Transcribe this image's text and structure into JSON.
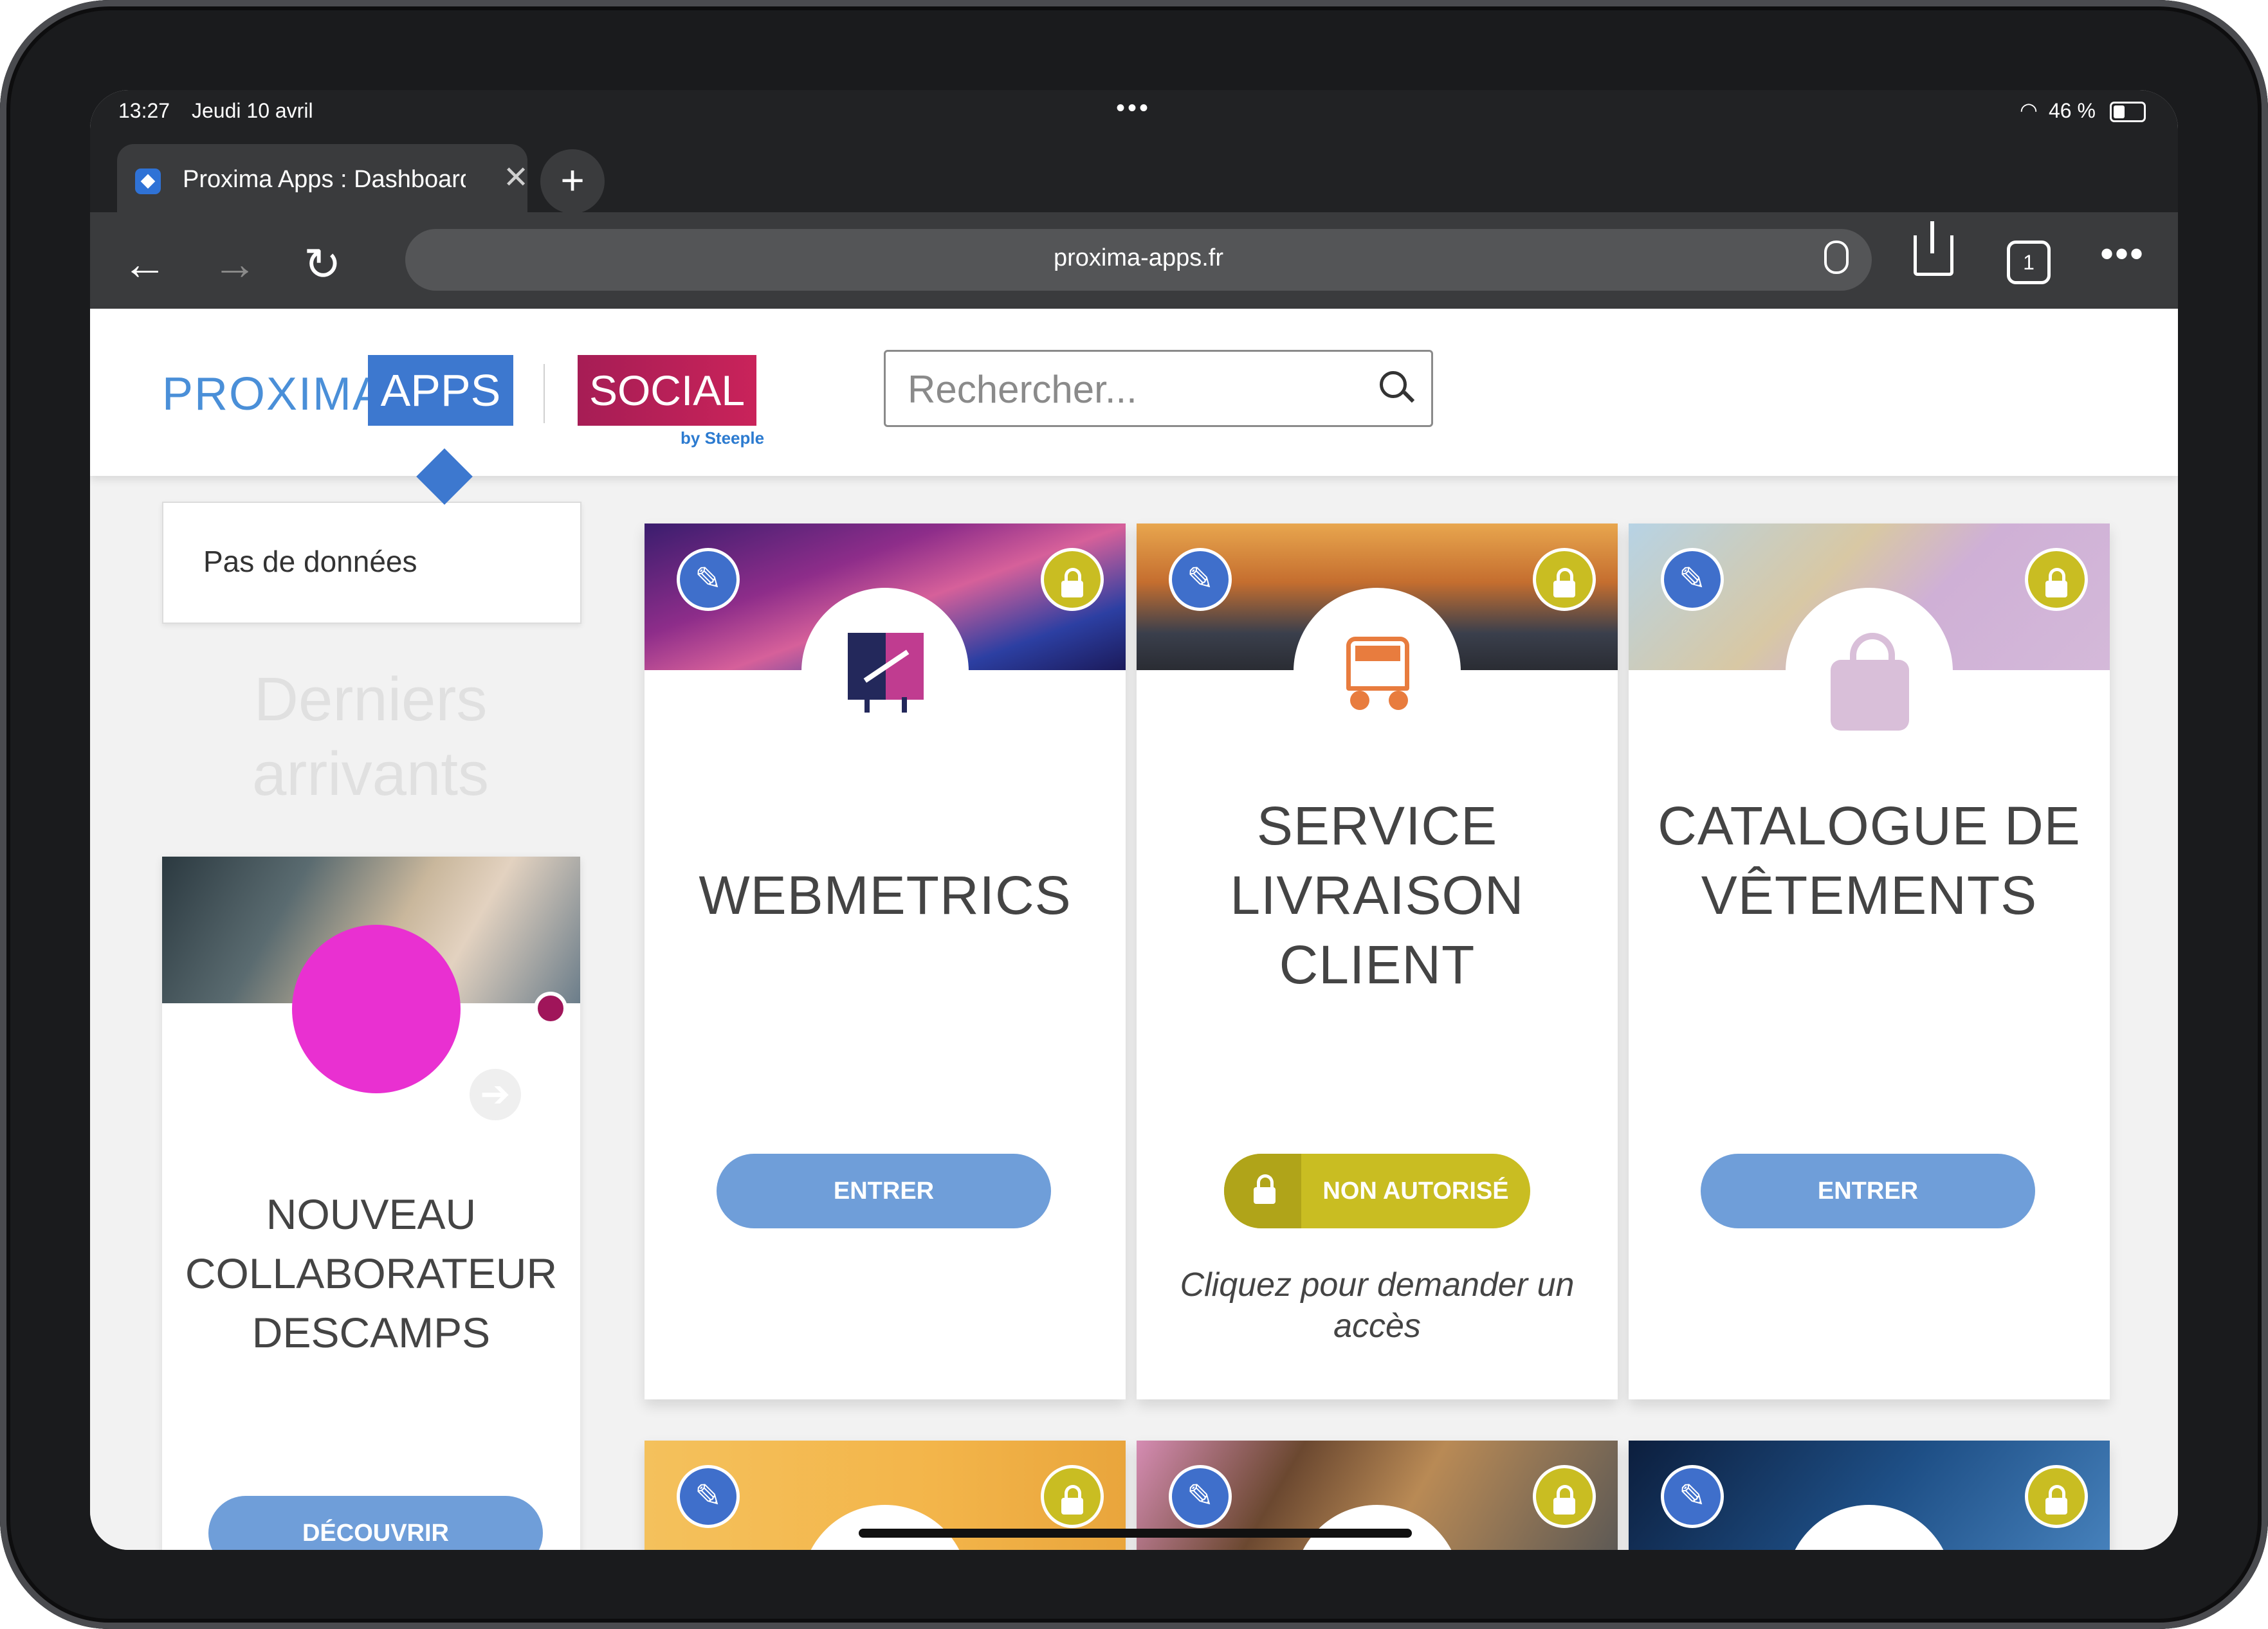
{
  "status_bar": {
    "time": "13:27",
    "date": "Jeudi 10 avril",
    "dots": "•••",
    "battery": "46 %",
    "battery_level": 0.46
  },
  "browser": {
    "tab_title": "Proxima Apps : Dashboard",
    "tab_close": "✕",
    "new_tab": "+",
    "back": "←",
    "forward": "→",
    "reload": "↻",
    "url": "proxima-apps.fr",
    "tab_count": "1",
    "more": "•••"
  },
  "header": {
    "logo_proxima": "PROXIMA",
    "logo_apps": "APPS",
    "logo_social": "SOCIAL",
    "logo_steeple": "by Steeple",
    "search_placeholder": "Rechercher..."
  },
  "sidebar": {
    "no_data": "Pas de données",
    "latest_title": "Derniers arrivants",
    "newcomer_name": "NOUVEAU COLLABORATEUR DESCAMPS",
    "discover_button": "DÉCOUVRIR",
    "arrow": "➔"
  },
  "apps": [
    {
      "title": "WEBMETRICS",
      "button": "ENTRER",
      "locked_access": false,
      "icon": "chart-presentation-icon"
    },
    {
      "title": "SERVICE LIVRAISON CLIENT",
      "button": "NON AUTORISÉ",
      "request_text": "Cliquez pour demander un accès",
      "locked_access": true,
      "icon": "truck-icon"
    },
    {
      "title": "CATALOGUE DE VÊTEMENTS",
      "button": "ENTRER",
      "locked_access": false,
      "icon": "shopping-bag-icon"
    }
  ],
  "colors": {
    "brand_blue": "#3d78cf",
    "social_red": "#c9235a",
    "button_blue": "#6f9ed9",
    "lock_yellow": "#c9bd22",
    "avatar_magenta": "#e930d1"
  }
}
